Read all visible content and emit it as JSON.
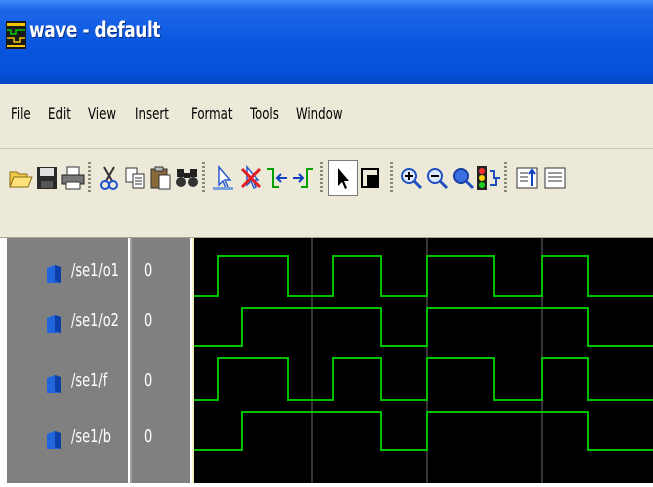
{
  "window": {
    "title": "wave - default",
    "icon": "modelsim-wave-icon"
  },
  "menu": [
    "File",
    "Edit",
    "View",
    "Insert",
    "Format",
    "Tools",
    "Window"
  ],
  "toolbar": {
    "buttons": [
      "open-folder-icon",
      "save-icon",
      "print-icon",
      "cut-icon",
      "copy-icon",
      "paste-icon",
      "find-icon",
      "insert-cursor-icon",
      "delete-cursor-icon",
      "previous-transition-icon",
      "next-transition-icon",
      "select-mode-icon",
      "zoom-mode-icon",
      "zoom-in-icon",
      "zoom-out-icon",
      "zoom-full-icon",
      "zoom-range-icon",
      "expand-icon",
      "collapse-icon"
    ],
    "pressed": "zoom-mode-icon"
  },
  "signals": [
    {
      "name": "/se1/o1",
      "value": "0"
    },
    {
      "name": "/se1/o2",
      "value": "0"
    },
    {
      "name": "/se1/f",
      "value": "0"
    },
    {
      "name": "/se1/b",
      "value": "0"
    }
  ],
  "colors": {
    "title_bar": "#0a58e0",
    "chrome": "#ece9d8",
    "panel": "#808080",
    "wave_background": "#000000",
    "wave_trace": "#00c000",
    "cursor_line": "#f2f2c0",
    "grid_line": "#6a6a6a"
  }
}
